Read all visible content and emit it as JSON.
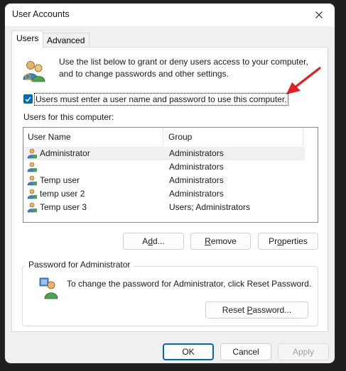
{
  "window": {
    "title": "User Accounts"
  },
  "tabs": [
    {
      "label": "Users",
      "active": true
    },
    {
      "label": "Advanced",
      "active": false
    }
  ],
  "intro": {
    "line1": "Use the list below to grant or deny users access to your computer,",
    "line2": "and to change passwords and other settings."
  },
  "require_password": {
    "label": "Users must enter a user name and password to use this computer.",
    "checked": true
  },
  "users": {
    "label": "Users for this computer:",
    "columns": [
      "User Name",
      "Group"
    ],
    "rows": [
      {
        "name": "Administrator",
        "group": "Administrators",
        "selected": true
      },
      {
        "name": "",
        "group": "Administrators",
        "selected": false
      },
      {
        "name": "Temp user",
        "group": "Administrators",
        "selected": false
      },
      {
        "name": "temp user 2",
        "group": "Administrators",
        "selected": false
      },
      {
        "name": "Temp user 3",
        "group": "Users; Administrators",
        "selected": false
      }
    ]
  },
  "list_buttons": {
    "add": {
      "pre": "A",
      "key": "d",
      "post": "d..."
    },
    "remove": {
      "pre": "",
      "key": "R",
      "post": "emove"
    },
    "properties": {
      "pre": "Pr",
      "key": "o",
      "post": "perties"
    }
  },
  "password": {
    "legend": "Password for Administrator",
    "text": "To change the password for Administrator, click Reset Password.",
    "reset": {
      "pre": "Reset ",
      "key": "P",
      "post": "assword..."
    }
  },
  "dialog_buttons": {
    "ok": "OK",
    "cancel": "Cancel",
    "apply": "Apply"
  },
  "colors": {
    "accent": "#0067c0",
    "annotation_arrow": "#e02020"
  }
}
